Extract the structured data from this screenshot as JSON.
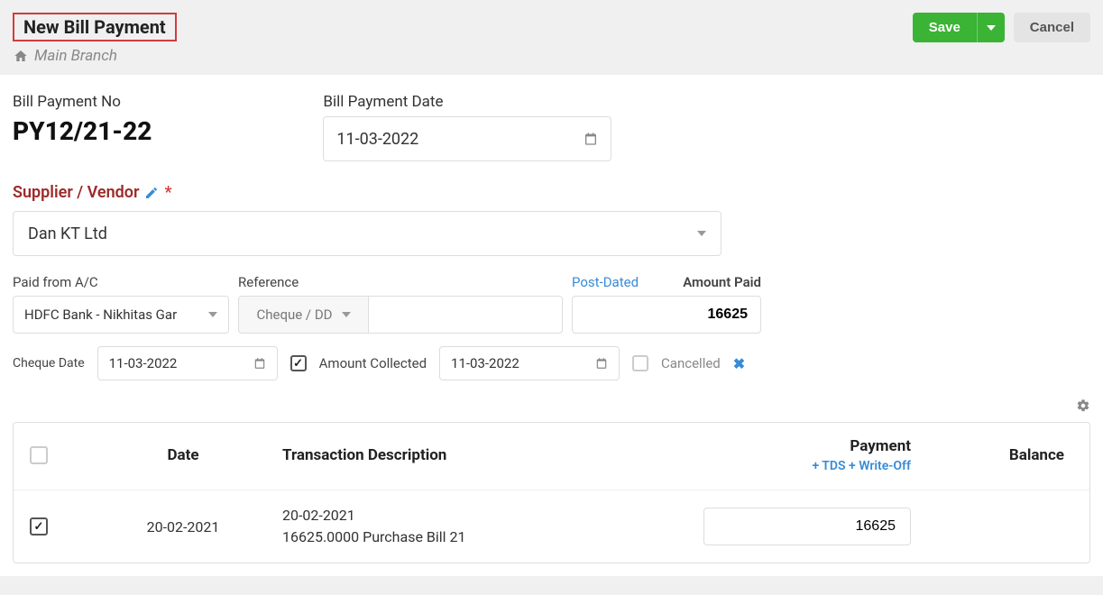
{
  "header": {
    "title": "New Bill Payment",
    "branch": "Main Branch",
    "save_label": "Save",
    "cancel_label": "Cancel"
  },
  "fields": {
    "bill_payment_no_label": "Bill Payment No",
    "bill_payment_no_value": "PY12/21-22",
    "bill_payment_date_label": "Bill Payment Date",
    "bill_payment_date_value": "11-03-2022",
    "supplier_label": "Supplier / Vendor",
    "supplier_value": "Dan KT Ltd",
    "paid_from_label": "Paid from A/C",
    "paid_from_value": "HDFC Bank - Nikhitas Gar",
    "reference_label": "Reference",
    "reference_type_value": "Cheque / DD",
    "reference_value": "",
    "post_dated_label": "Post-Dated",
    "amount_paid_label": "Amount Paid",
    "amount_paid_value": "16625",
    "cheque_date_label": "Cheque Date",
    "cheque_date_value": "11-03-2022",
    "amount_collected_label": "Amount Collected",
    "amount_collected_checked": true,
    "collected_date_value": "11-03-2022",
    "cancelled_label": "Cancelled",
    "cancelled_checked": false
  },
  "table": {
    "columns": {
      "date": "Date",
      "description": "Transaction Description",
      "payment": "Payment",
      "payment_sub": "+ TDS + Write-Off",
      "balance": "Balance"
    },
    "rows": [
      {
        "checked": true,
        "date": "20-02-2021",
        "desc_line1": "20-02-2021",
        "desc_line2": "16625.0000 Purchase Bill  21",
        "payment": "16625",
        "balance": ""
      }
    ]
  }
}
